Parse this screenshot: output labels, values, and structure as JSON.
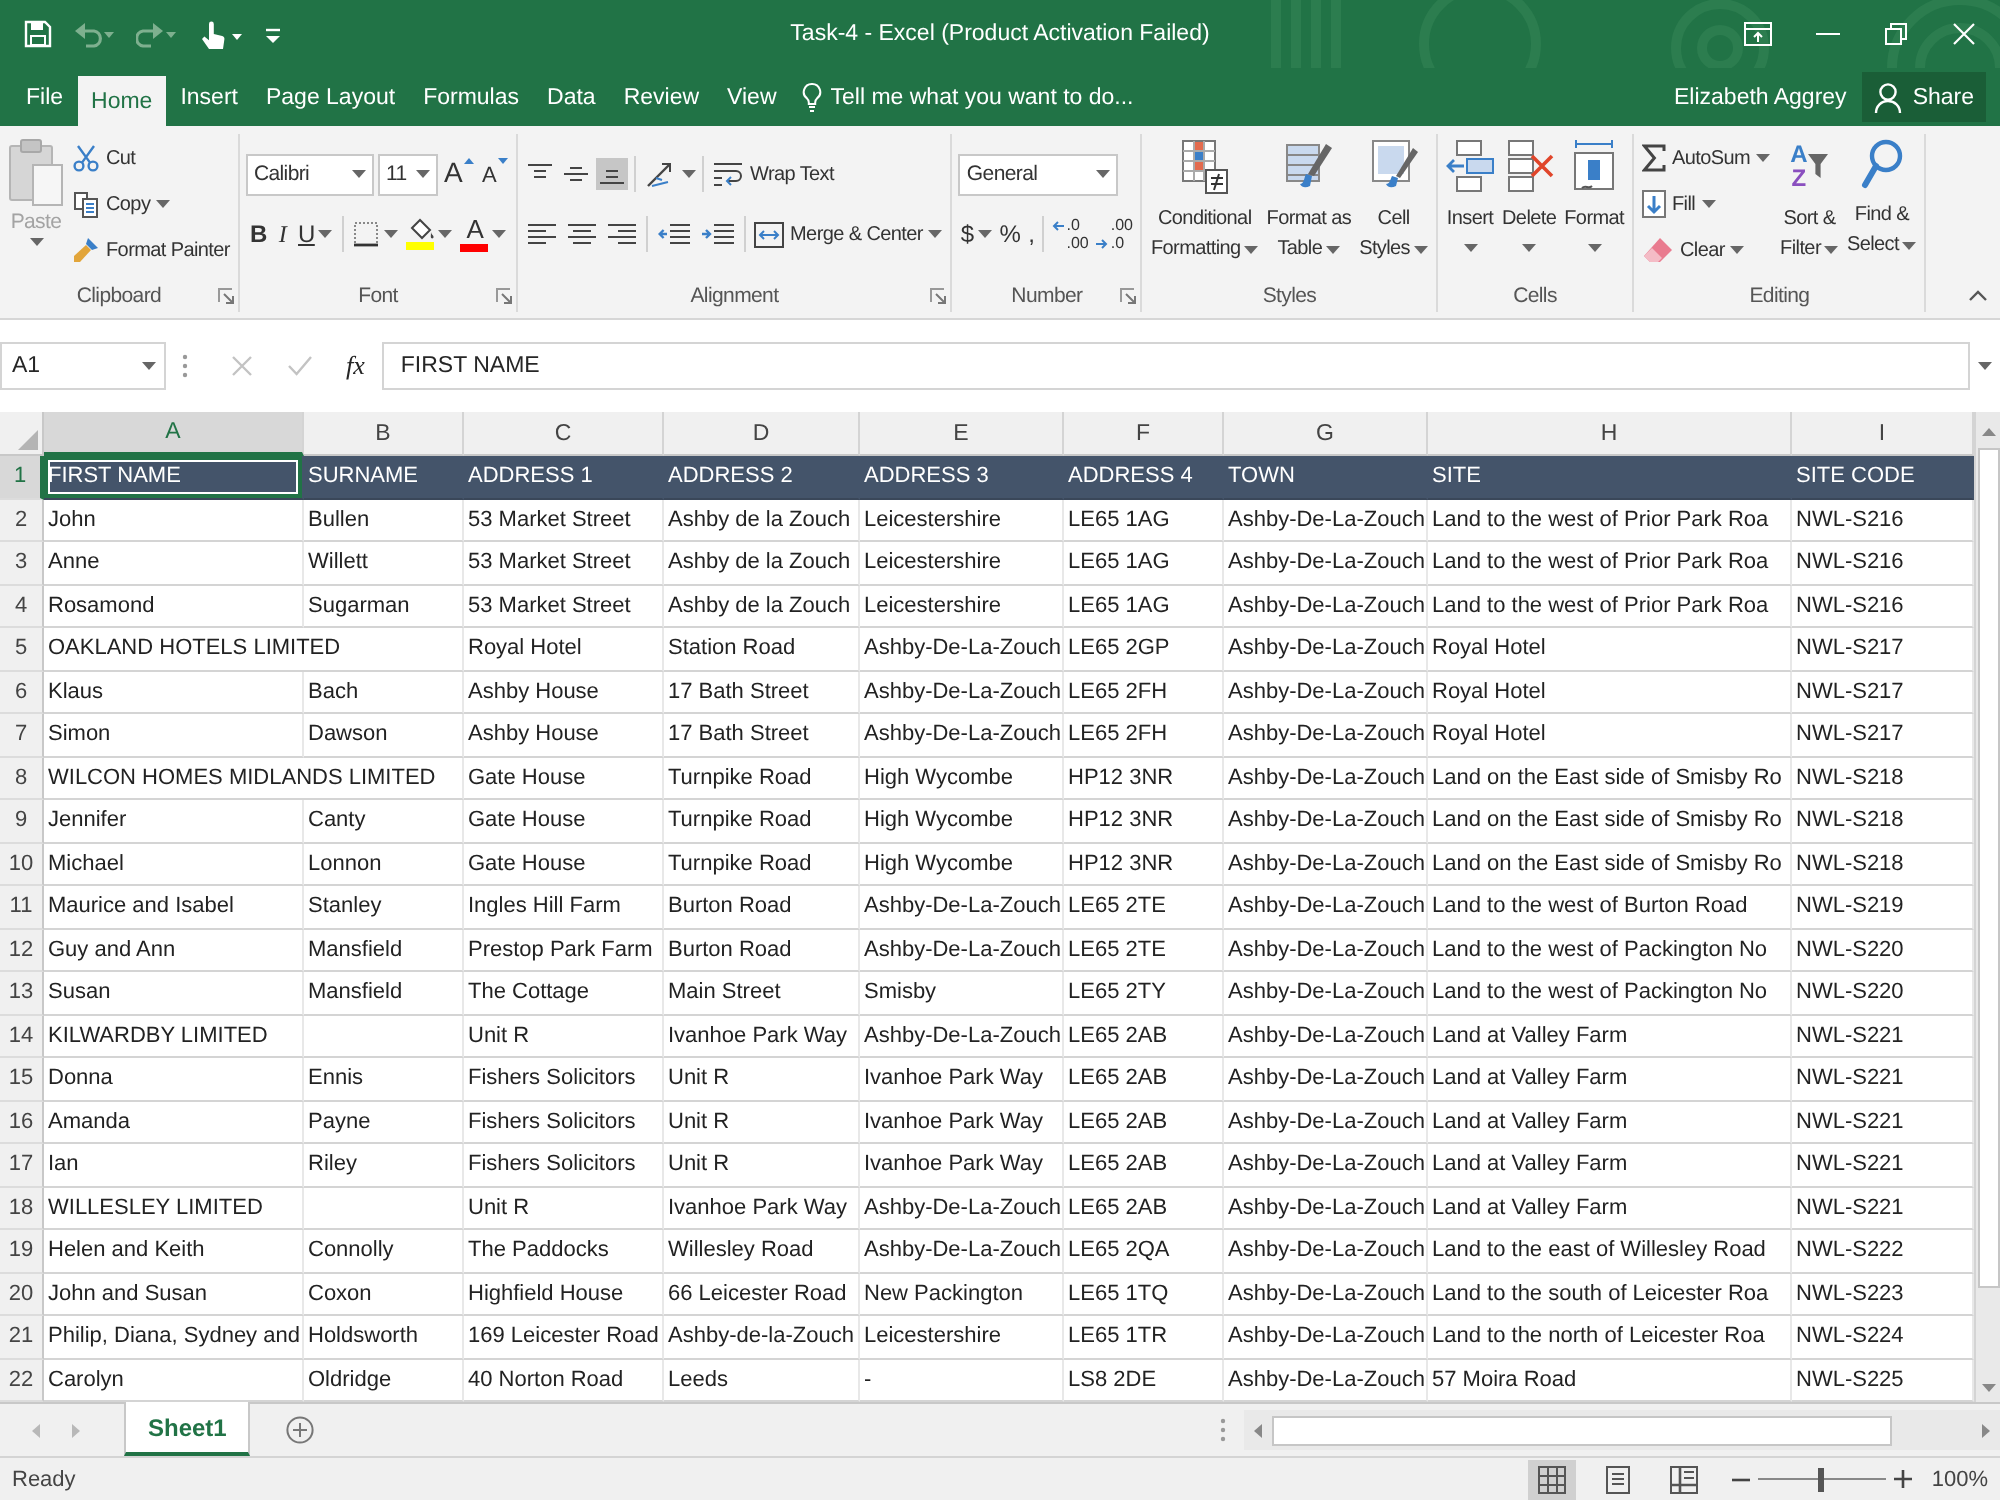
{
  "title_bar": {
    "title": "Task-4 - Excel (Product Activation Failed)",
    "quick_access": [
      {
        "kind": "save",
        "disabled": false
      },
      {
        "kind": "undo",
        "disabled": true
      },
      {
        "kind": "redo",
        "disabled": true
      },
      {
        "kind": "touch",
        "disabled": false
      },
      {
        "kind": "customize",
        "disabled": false
      }
    ],
    "window_controls": [
      {
        "kind": "ribbon_options"
      },
      {
        "kind": "minimize"
      },
      {
        "kind": "restore"
      },
      {
        "kind": "close"
      }
    ]
  },
  "ribbon_tabs": [
    {
      "label": "File",
      "selected": false
    },
    {
      "label": "Home",
      "selected": true
    },
    {
      "label": "Insert",
      "selected": false
    },
    {
      "label": "Page Layout",
      "selected": false
    },
    {
      "label": "Formulas",
      "selected": false
    },
    {
      "label": "Data",
      "selected": false
    },
    {
      "label": "Review",
      "selected": false
    },
    {
      "label": "View",
      "selected": false
    }
  ],
  "tell_me": {
    "placeholder": "Tell me what you want to do..."
  },
  "account": {
    "user": "Elizabeth Aggrey",
    "share": "Share"
  },
  "ribbon": {
    "groups": [
      {
        "kind": "clipboard",
        "label": "Clipboard",
        "launcher": true,
        "paste": {
          "label": "Paste",
          "disabled": true
        },
        "commands": [
          {
            "kind": "cut",
            "label": "Cut",
            "dropdown": false
          },
          {
            "kind": "copy",
            "label": "Copy",
            "dropdown": true
          },
          {
            "kind": "format_painter",
            "label": "Format Painter",
            "dropdown": false
          }
        ]
      },
      {
        "kind": "font",
        "label": "Font",
        "launcher": true,
        "font_name": "Calibri",
        "font_size": "11",
        "size_buttons": [
          {
            "kind": "grow",
            "label": "A"
          },
          {
            "kind": "shrink",
            "label": "A"
          }
        ],
        "style_buttons": [
          {
            "kind": "bold",
            "label": "B",
            "dropdown": false
          },
          {
            "kind": "italic",
            "label": "I",
            "dropdown": false
          },
          {
            "kind": "underline",
            "label": "U",
            "dropdown": true
          }
        ],
        "color_buttons": [
          {
            "kind": "borders",
            "dropdown": true
          },
          {
            "kind": "fill",
            "color": "#ffff00",
            "dropdown": true
          },
          {
            "kind": "font_color",
            "label": "A",
            "color": "#ff0000",
            "dropdown": true
          }
        ]
      },
      {
        "kind": "alignment",
        "label": "Alignment",
        "launcher": true,
        "vertical": [
          {
            "kind": "top",
            "selected": false
          },
          {
            "kind": "middle",
            "selected": false
          },
          {
            "kind": "bottom",
            "selected": true
          }
        ],
        "orientation": {
          "dropdown": true
        },
        "wrap_text": "Wrap Text",
        "horizontal": [
          {
            "kind": "left",
            "selected": false
          },
          {
            "kind": "center",
            "selected": false
          },
          {
            "kind": "right",
            "selected": false
          }
        ],
        "indent": [
          {
            "kind": "decrease"
          },
          {
            "kind": "increase"
          }
        ],
        "merge": {
          "label": "Merge & Center",
          "dropdown": true
        }
      },
      {
        "kind": "number",
        "label": "Number",
        "launcher": true,
        "format": "General",
        "buttons": [
          {
            "kind": "currency",
            "label": "$",
            "dropdown": true
          },
          {
            "kind": "percent",
            "label": "%",
            "dropdown": false
          },
          {
            "kind": "comma",
            "label": ",",
            "dropdown": false
          }
        ],
        "decimals": [
          {
            "kind": "increase",
            "lines": [
              ".0",
              ".00"
            ]
          },
          {
            "kind": "decrease",
            "lines": [
              ".00",
              ".0"
            ]
          }
        ]
      },
      {
        "kind": "styles",
        "label": "Styles",
        "launcher": false,
        "buttons": [
          {
            "kind": "conditional",
            "lines": [
              "Conditional",
              "Formatting"
            ]
          },
          {
            "kind": "table",
            "lines": [
              "Format as",
              "Table"
            ]
          },
          {
            "kind": "cell_styles",
            "lines": [
              "Cell",
              "Styles"
            ]
          }
        ]
      },
      {
        "kind": "cells",
        "label": "Cells",
        "launcher": false,
        "buttons": [
          {
            "kind": "insert",
            "label": "Insert"
          },
          {
            "kind": "delete",
            "label": "Delete"
          },
          {
            "kind": "format",
            "label": "Format"
          }
        ]
      },
      {
        "kind": "editing",
        "label": "Editing",
        "launcher": false,
        "small": [
          {
            "kind": "autosum",
            "label": "AutoSum"
          },
          {
            "kind": "fill",
            "label": "Fill"
          },
          {
            "kind": "clear",
            "label": "Clear"
          }
        ],
        "large": [
          {
            "kind": "sort",
            "letters": [
              "A",
              "Z"
            ],
            "lines": [
              "Sort &",
              "Filter"
            ]
          },
          {
            "kind": "find",
            "lines": [
              "Find &",
              "Select"
            ]
          }
        ]
      }
    ]
  },
  "formula_bar": {
    "name_box": "A1",
    "cancel": {
      "disabled": true
    },
    "enter": {
      "disabled": true
    },
    "function_label": "fx",
    "value": "FIRST NAME"
  },
  "sheet": {
    "columns": [
      {
        "letter": "A",
        "selected": true
      },
      {
        "letter": "B",
        "selected": false
      },
      {
        "letter": "C",
        "selected": false
      },
      {
        "letter": "D",
        "selected": false
      },
      {
        "letter": "E",
        "selected": false
      },
      {
        "letter": "F",
        "selected": false
      },
      {
        "letter": "G",
        "selected": false
      },
      {
        "letter": "H",
        "selected": false
      },
      {
        "letter": "I",
        "selected": false
      }
    ],
    "rows": [
      {
        "number": "1",
        "kind": "header",
        "selected": true,
        "cells": [
          "FIRST NAME",
          "SURNAME",
          "ADDRESS 1",
          "ADDRESS 2",
          "ADDRESS 3",
          "ADDRESS 4",
          "TOWN",
          "SITE",
          "SITE CODE"
        ]
      },
      {
        "number": "2",
        "kind": "data",
        "selected": false,
        "cells": [
          "John",
          "Bullen",
          "53 Market Street",
          "Ashby de la Zouch",
          "Leicestershire",
          "LE65 1AG",
          "Ashby-De-La-Zouch",
          "Land to the west of Prior Park Roa",
          "NWL-S216"
        ]
      },
      {
        "number": "3",
        "kind": "data",
        "selected": false,
        "cells": [
          "Anne",
          "Willett",
          "53 Market Street",
          "Ashby de la Zouch",
          "Leicestershire",
          "LE65 1AG",
          "Ashby-De-La-Zouch",
          "Land to the west of Prior Park Roa",
          "NWL-S216"
        ]
      },
      {
        "number": "4",
        "kind": "data",
        "selected": false,
        "cells": [
          "Rosamond",
          "Sugarman",
          "53 Market Street",
          "Ashby de la Zouch",
          "Leicestershire",
          "LE65 1AG",
          "Ashby-De-La-Zouch",
          "Land to the west of Prior Park Roa",
          "NWL-S216"
        ]
      },
      {
        "number": "5",
        "kind": "data",
        "selected": false,
        "cells": [
          "OAKLAND HOTELS LIMITED",
          null,
          "Royal Hotel",
          "Station Road",
          "Ashby-De-La-Zouch",
          "LE65 2GP",
          "Ashby-De-La-Zouch",
          "Royal Hotel",
          "NWL-S217"
        ]
      },
      {
        "number": "6",
        "kind": "data",
        "selected": false,
        "cells": [
          "Klaus",
          "Bach",
          "Ashby House",
          "17 Bath Street",
          "Ashby-De-La-Zouch",
          "LE65 2FH",
          "Ashby-De-La-Zouch",
          "Royal Hotel",
          "NWL-S217"
        ]
      },
      {
        "number": "7",
        "kind": "data",
        "selected": false,
        "cells": [
          "Simon",
          "Dawson",
          "Ashby House",
          "17 Bath Street",
          "Ashby-De-La-Zouch",
          "LE65 2FH",
          "Ashby-De-La-Zouch",
          "Royal Hotel",
          "NWL-S217"
        ]
      },
      {
        "number": "8",
        "kind": "data",
        "selected": false,
        "cells": [
          "WILCON HOMES MIDLANDS LIMITED",
          null,
          "Gate House",
          "Turnpike Road",
          "High Wycombe",
          "HP12 3NR",
          "Ashby-De-La-Zouch",
          "Land on the East side of Smisby Ro",
          "NWL-S218"
        ]
      },
      {
        "number": "9",
        "kind": "data",
        "selected": false,
        "cells": [
          "Jennifer",
          "Canty",
          "Gate House",
          "Turnpike Road",
          "High Wycombe",
          "HP12 3NR",
          "Ashby-De-La-Zouch",
          "Land on the East side of Smisby Ro",
          "NWL-S218"
        ]
      },
      {
        "number": "10",
        "kind": "data",
        "selected": false,
        "cells": [
          "Michael",
          "Lonnon",
          "Gate House",
          "Turnpike Road",
          "High Wycombe",
          "HP12 3NR",
          "Ashby-De-La-Zouch",
          "Land on the East side of Smisby Ro",
          "NWL-S218"
        ]
      },
      {
        "number": "11",
        "kind": "data",
        "selected": false,
        "cells": [
          "Maurice and Isabel",
          "Stanley",
          "Ingles Hill Farm",
          "Burton Road",
          "Ashby-De-La-Zouch",
          "LE65 2TE",
          "Ashby-De-La-Zouch",
          "Land to the west of Burton Road",
          "NWL-S219"
        ]
      },
      {
        "number": "12",
        "kind": "data",
        "selected": false,
        "cells": [
          "Guy and Ann",
          "Mansfield",
          "Prestop Park Farm",
          "Burton Road",
          "Ashby-De-La-Zouch",
          "LE65 2TE",
          "Ashby-De-La-Zouch",
          "Land to the west of Packington No",
          "NWL-S220"
        ]
      },
      {
        "number": "13",
        "kind": "data",
        "selected": false,
        "cells": [
          "Susan",
          "Mansfield",
          "The Cottage",
          "Main Street",
          "Smisby",
          "LE65 2TY",
          "Ashby-De-La-Zouch",
          "Land to the west of Packington No",
          "NWL-S220"
        ]
      },
      {
        "number": "14",
        "kind": "data",
        "selected": false,
        "cells": [
          "KILWARDBY LIMITED",
          null,
          "Unit R",
          "Ivanhoe Park Way",
          "Ashby-De-La-Zouch",
          "LE65 2AB",
          "Ashby-De-La-Zouch",
          "Land at Valley Farm",
          "NWL-S221"
        ]
      },
      {
        "number": "15",
        "kind": "data",
        "selected": false,
        "cells": [
          "Donna",
          "Ennis",
          "Fishers Solicitors",
          "Unit R",
          "Ivanhoe Park Way",
          "LE65 2AB",
          "Ashby-De-La-Zouch",
          "Land at Valley Farm",
          "NWL-S221"
        ]
      },
      {
        "number": "16",
        "kind": "data",
        "selected": false,
        "cells": [
          "Amanda",
          "Payne",
          "Fishers Solicitors",
          "Unit R",
          "Ivanhoe Park Way",
          "LE65 2AB",
          "Ashby-De-La-Zouch",
          "Land at Valley Farm",
          "NWL-S221"
        ]
      },
      {
        "number": "17",
        "kind": "data",
        "selected": false,
        "cells": [
          "Ian",
          "Riley",
          "Fishers Solicitors",
          "Unit R",
          "Ivanhoe Park Way",
          "LE65 2AB",
          "Ashby-De-La-Zouch",
          "Land at Valley Farm",
          "NWL-S221"
        ]
      },
      {
        "number": "18",
        "kind": "data",
        "selected": false,
        "cells": [
          "WILLESLEY LIMITED",
          null,
          "Unit R",
          "Ivanhoe Park Way",
          "Ashby-De-La-Zouch",
          "LE65 2AB",
          "Ashby-De-La-Zouch",
          "Land at Valley Farm",
          "NWL-S221"
        ]
      },
      {
        "number": "19",
        "kind": "data",
        "selected": false,
        "cells": [
          "Helen and Keith",
          "Connolly",
          "The Paddocks",
          "Willesley Road",
          "Ashby-De-La-Zouch",
          "LE65 2QA",
          "Ashby-De-La-Zouch",
          "Land to the east of Willesley Road",
          "NWL-S222"
        ]
      },
      {
        "number": "20",
        "kind": "data",
        "selected": false,
        "cells": [
          "John and Susan",
          "Coxon",
          "Highfield House",
          "66 Leicester Road",
          "New Packington",
          "LE65 1TQ",
          "Ashby-De-La-Zouch",
          "Land to the south of Leicester Roa",
          "NWL-S223"
        ]
      },
      {
        "number": "21",
        "kind": "data",
        "selected": false,
        "cells": [
          "Philip, Diana, Sydney and",
          "Holdsworth",
          "169 Leicester Road",
          "Ashby-de-la-Zouch",
          "Leicestershire",
          "LE65 1TR",
          "Ashby-De-La-Zouch",
          "Land to the north of Leicester Roa",
          "NWL-S224"
        ]
      },
      {
        "number": "22",
        "kind": "data",
        "selected": false,
        "cells": [
          "Carolyn",
          "Oldridge",
          "40 Norton Road",
          "Leeds",
          "-",
          "LS8 2DE",
          "Ashby-De-La-Zouch",
          "57 Moira Road",
          "NWL-S225"
        ]
      }
    ]
  },
  "sheet_tabs": [
    {
      "label": "Sheet1",
      "selected": true
    }
  ],
  "status_bar": {
    "status": "Ready",
    "views": [
      {
        "kind": "normal",
        "selected": true
      },
      {
        "kind": "page_layout",
        "selected": false
      },
      {
        "kind": "page_break",
        "selected": false
      }
    ],
    "zoom": {
      "level": 0.5,
      "reading": "100%"
    }
  }
}
